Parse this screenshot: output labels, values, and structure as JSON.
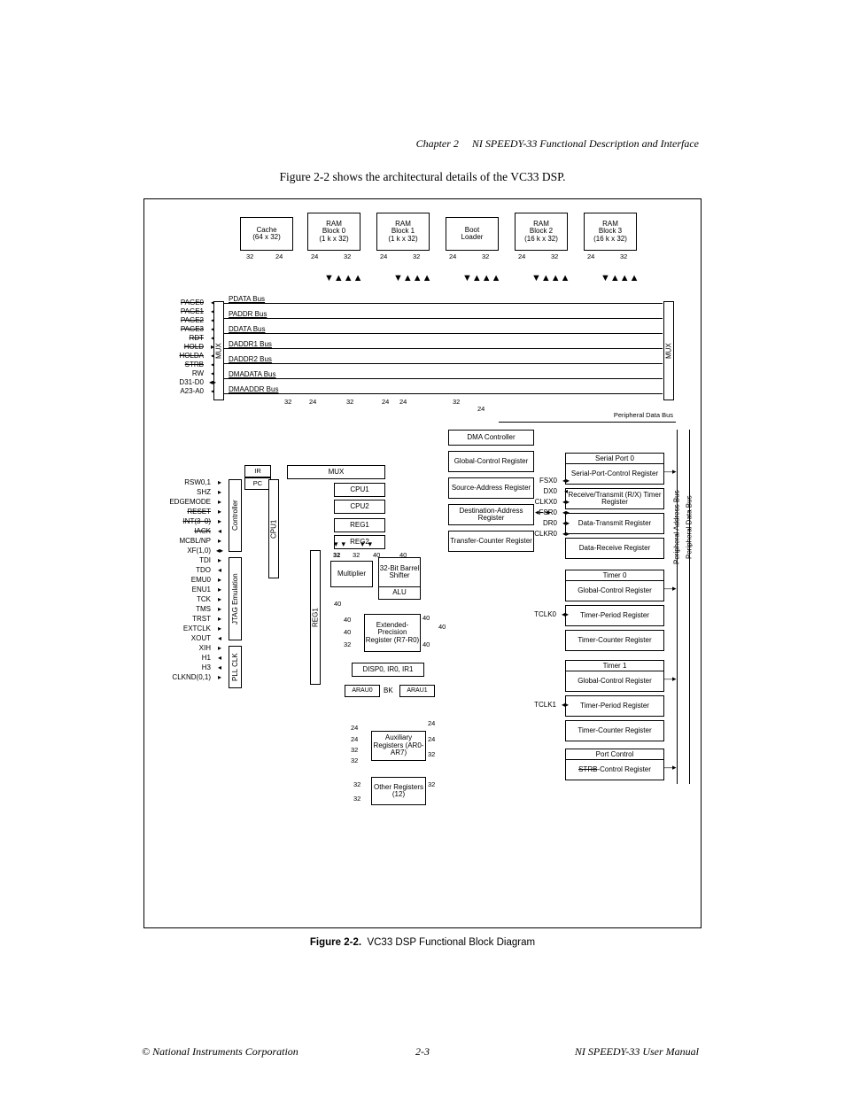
{
  "header": {
    "chapter": "Chapter 2",
    "section_title": "NI SPEEDY-33 Functional Description and Interface"
  },
  "intro_text": "Figure 2-2 shows the architectural details of the VC33 DSP.",
  "top_blocks": [
    {
      "id": "cache",
      "lines": [
        "Cache",
        "(64 x 32)"
      ]
    },
    {
      "id": "ram0",
      "lines": [
        "RAM",
        "Block 0",
        "(1 k x 32)"
      ]
    },
    {
      "id": "ram1",
      "lines": [
        "RAM",
        "Block 1",
        "(1 k x 32)"
      ]
    },
    {
      "id": "boot",
      "lines": [
        "Boot",
        "Loader"
      ]
    },
    {
      "id": "ram2",
      "lines": [
        "RAM",
        "Block 2",
        "(16 k x 32)"
      ]
    },
    {
      "id": "ram3",
      "lines": [
        "RAM",
        "Block 3",
        "(16 k x 32)"
      ]
    }
  ],
  "top_widths": {
    "cache_l": "32",
    "cache_r": "24",
    "ram0_l": "24",
    "ram0_r": "32",
    "ram1_l": "24",
    "ram1_r": "32",
    "boot_l": "24",
    "boot_r": "32",
    "ram2_l": "24",
    "ram2_r": "32",
    "ram3_l": "24",
    "ram3_r": "32"
  },
  "left_signals_top": [
    {
      "name": "PAGE0",
      "strike": true
    },
    {
      "name": "PAGE1",
      "strike": true
    },
    {
      "name": "PAGE2",
      "strike": true
    },
    {
      "name": "PAGE3",
      "strike": true
    },
    {
      "name": "RDT",
      "strike": true
    },
    {
      "name": "HOLD",
      "strike": true
    },
    {
      "name": "HOLDA",
      "strike": true
    },
    {
      "name": "STRB",
      "strike": true
    },
    {
      "name": "RW",
      "strike": false
    },
    {
      "name": "D31-D0",
      "strike": false
    },
    {
      "name": "A23-A0",
      "strike": false
    }
  ],
  "bus_labels": [
    "PDATA Bus",
    "PADDR Bus",
    "DDATA Bus",
    "DADDR1 Bus",
    "DADDR2 Bus",
    "DMADATA Bus",
    "DMAADDR Bus"
  ],
  "below_bus_widths": [
    "32",
    "24",
    "32",
    "24",
    "24",
    "32",
    "24"
  ],
  "left_signals_mid": [
    "RSW0,1",
    "SHZ",
    "EDGEMODE",
    "RESET",
    "INT(3–0)",
    "IACK",
    "MCBL/NP",
    "XF(1,0)",
    "TDI",
    "TDO",
    "EMU0",
    "ENU1",
    "TCK",
    "TMS",
    "TRST",
    "EXTCLK",
    "XOUT",
    "XIH",
    "H1",
    "H3",
    "CLKND(0,1)"
  ],
  "left_col_boxes": [
    {
      "id": "ir",
      "label": "IR"
    },
    {
      "id": "pc",
      "label": "PC"
    }
  ],
  "vert_labels": {
    "controller": "Controller",
    "jtag": "JTAG Emulation",
    "pllclk": "PLL CLK",
    "cpu1": "CPU1",
    "reg1": "REG1",
    "mux_left": "MUX",
    "mux_right": "MUX",
    "periph_addr_bus": "Peripheral Address Bus",
    "periph_data_bus": "Peripheral Data Bus",
    "periph_data_bus_top": "Peripheral Data Bus"
  },
  "cpu_stack": [
    "MUX",
    "CPU1",
    "CPU2",
    "REG1",
    "REG2"
  ],
  "cpu_widths": [
    "32",
    "32",
    "40",
    "40"
  ],
  "dma_blocks": {
    "controller": "DMA Controller",
    "global_ctrl": "Global-Control Register",
    "src_addr": "Source-Address Register",
    "dest_addr": "Destination-Address Register",
    "xfer_cnt": "Transfer-Counter Register"
  },
  "serial_port_hdr": "Serial Port 0",
  "serial_port_regs": [
    "Serial-Port-Control Register",
    "Receive/Transmit (R/X) Timer Register",
    "Data-Transmit Register",
    "Data-Receive Register"
  ],
  "serial_signals": [
    "FSX0",
    "DX0",
    "CLKX0",
    "FSR0",
    "DR0",
    "CLKR0"
  ],
  "timer0_hdr": "Timer 0",
  "timer0_regs": [
    "Global-Control Register",
    "Timer-Period Register",
    "Timer-Counter Register"
  ],
  "timer0_signal": "TCLK0",
  "timer1_hdr": "Timer 1",
  "timer1_regs": [
    "Global-Control Register",
    "Timer-Period Register",
    "Timer-Counter Register"
  ],
  "timer1_signal": "TCLK1",
  "port_ctrl_hdr": "Port Control",
  "port_ctrl_reg": "STRB-Control Register",
  "port_ctrl_reg_pre": "STRB",
  "port_ctrl_reg_suf": "-Control Register",
  "datapath": {
    "multiplier": "Multiplier",
    "barrel": "32-Bit Barrel Shifter",
    "alu": "ALU",
    "ext_prec": "Extended-Precision Register (R7-R0)",
    "disp": "DISP0, IR0, IR1",
    "arau0": "ARAU0",
    "arau1": "ARAU1",
    "bk": "BK",
    "aux_regs": "Auxiliary Registers (AR0-AR7)",
    "other_regs": "Other Registers (12)",
    "w40": "40",
    "w40b": "40",
    "w40c": "40",
    "w40d": "40",
    "w32a": "32",
    "w32b": "32",
    "w32c": "32",
    "w32d": "32",
    "w24a": "24",
    "w24b": "24",
    "w24c": "24",
    "w24d": "24"
  },
  "caption": {
    "label": "Figure 2-2.",
    "text": "VC33 DSP Functional Block Diagram"
  },
  "footer": {
    "left": "© National Instruments Corporation",
    "center": "2-3",
    "right": "NI SPEEDY-33 User Manual"
  }
}
